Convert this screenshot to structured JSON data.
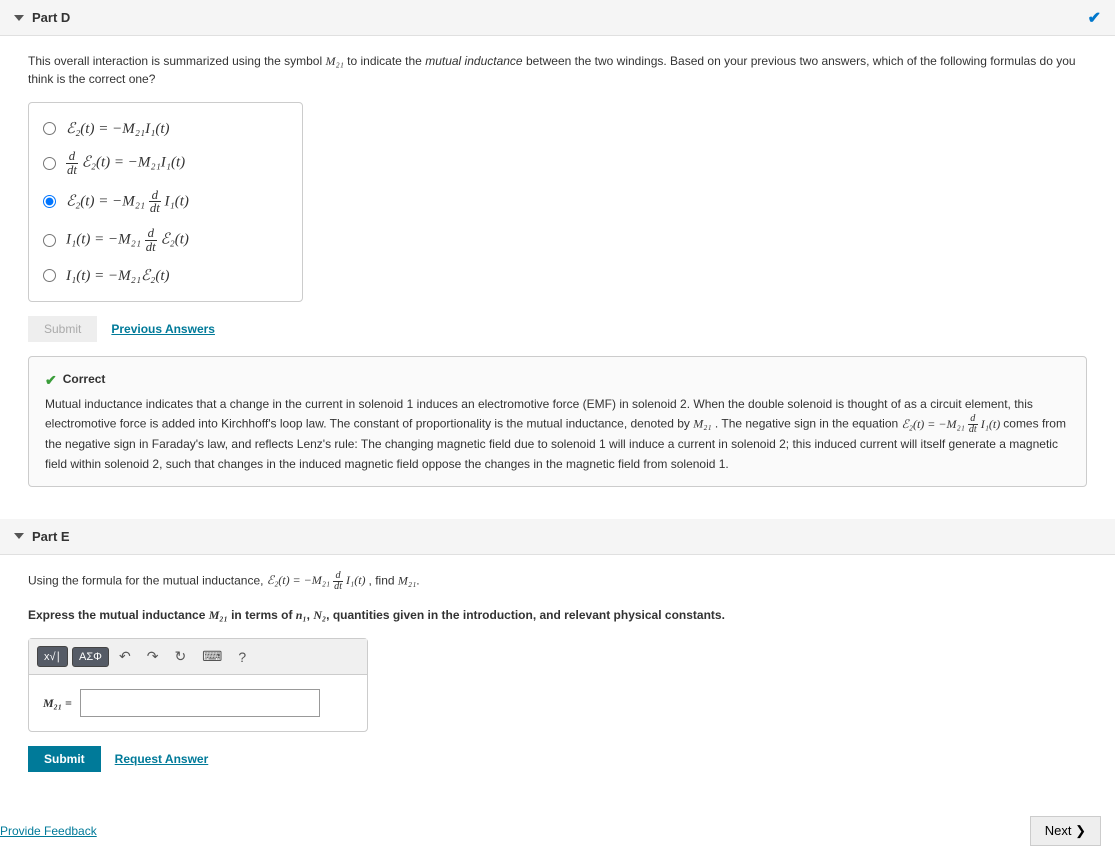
{
  "partD": {
    "title": "Part D",
    "prompt_prefix": "This overall interaction is summarized using the symbol ",
    "prompt_symbol": "M₂₁",
    "prompt_mid": " to indicate the ",
    "prompt_mutual": "mutual inductance",
    "prompt_suffix": " between the two windings. Based on your previous two answers, which of the following formulas do you think is the correct one?",
    "options": {
      "o1": "ℰ₂(t) = −M₂₁I₁(t)",
      "o2_lhs_frac_top": "d",
      "o2_lhs_frac_bot": "dt",
      "o2_rest": "ℰ₂(t) = −M₂₁I₁(t)",
      "o3_lhs": "ℰ₂(t) = −M₂₁",
      "o3_frac_top": "d",
      "o3_frac_bot": "dt",
      "o3_rhs": "I₁(t)",
      "o4_lhs": "I₁(t) = −M₂₁",
      "o4_frac_top": "d",
      "o4_frac_bot": "dt",
      "o4_rhs": "ℰ₂(t)",
      "o5": "I₁(t) = −M₂₁ℰ₂(t)"
    },
    "submit_label": "Submit",
    "prev_answers_label": "Previous Answers",
    "feedback": {
      "title": "Correct",
      "line1_a": "Mutual inductance indicates that a change in the current in solenoid 1 induces an electromotive force (EMF) in solenoid 2. When the double solenoid is thought of as a circuit element, this electromotive force is added into Kirchhoff's loop law. The constant of proportionality is the mutual inductance, denoted by ",
      "m21": "M₂₁",
      "line1_b": ". The negative sign in the equation ",
      "eq_lhs": "ℰ₂(t) = −M₂₁",
      "eq_frac_top": "d",
      "eq_frac_bot": "dt",
      "eq_rhs": "I₁(t)",
      "line1_c": " comes from the negative sign in Faraday's law, and reflects Lenz's rule: The changing magnetic field due to solenoid 1 will induce a current in solenoid 2; this induced current will itself generate a magnetic field within solenoid 2, such that changes in the induced magnetic field oppose the changes in the magnetic field from solenoid 1."
    }
  },
  "partE": {
    "title": "Part E",
    "prompt_a": "Using the formula for the mutual inductance, ",
    "eq_lhs": "ℰ₂(t) = −M₂₁",
    "eq_frac_top": "d",
    "eq_frac_bot": "dt",
    "eq_rhs": "I₁(t)",
    "prompt_b": ", find ",
    "prompt_m21": "M₂₁",
    "prompt_c": ".",
    "express_a": "Express the mutual inductance ",
    "express_m21": "M₂₁",
    "express_b": " in terms of ",
    "express_n1": "n₁",
    "express_comma": ", ",
    "express_n2": "N₂",
    "express_c": ", quantities given in the introduction, and relevant physical constants.",
    "answer_label": "M₂₁ =",
    "toolbar": {
      "templates": "x√∣",
      "greek": "ΑΣΦ",
      "undo": "↶",
      "redo": "↷",
      "reset": "↻",
      "keyboard": "⌨",
      "help": "?"
    },
    "submit_label": "Submit",
    "request_label": "Request Answer"
  },
  "footer": {
    "provide_feedback": "Provide Feedback",
    "next": "Next ❯"
  }
}
